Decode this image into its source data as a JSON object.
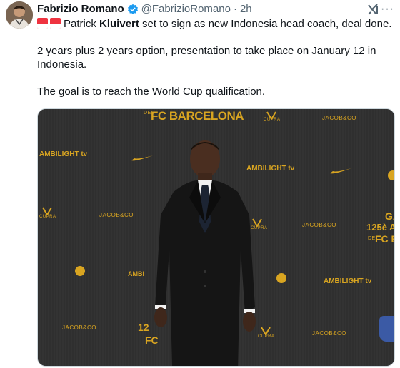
{
  "author": {
    "name": "Fabrizio Romano",
    "handle": "@FabrizioRomano",
    "separator": "·",
    "time": "2h",
    "verified": true
  },
  "header_icons": {
    "grok": "grok-icon",
    "more": "more-options-icon",
    "more_glyph": "···"
  },
  "tweet": {
    "line1_pre": "Patrick ",
    "line1_bold": "Kluivert",
    "line1_post": " set to sign as new Indonesia head coach, deal done.",
    "line2": "2 years plus 2 years option, presentation to take place on January 12 in Indonesia.",
    "line3": "The goal is to reach the World Cup qualification.",
    "flags": [
      "flag-singapore-icon",
      "flag-indonesia-icon"
    ]
  },
  "media": {
    "backdrop_texts": {
      "barcelona_top": "FC BARCELONA",
      "barcelona_top_small": "DEL",
      "ambilight_1": "AMBILIGHT tv",
      "ambilight_2": "AMBILIGHT tv",
      "ambilight_3": "AMBILIGHT tv",
      "ambilight_partial": "AMBI",
      "jacob_1": "JACOB&CO",
      "jacob_2": "JACOB&CO",
      "jacob_3": "JACOB&CO",
      "jacob_4": "JACOB&CO",
      "jacob_5": "JACOB&CO",
      "cupra_1": "CUPRA",
      "cupra_2": "CUPRA",
      "cupra_3": "CUPRA",
      "cupra_4": "CUPRA",
      "right_ga": "GA",
      "right_125": "125è A",
      "right_fcba": "FC BA",
      "right_del": "DEL",
      "bottom_125": "12",
      "bottom_fc": "FC"
    },
    "colors": {
      "gold": "#d9a521",
      "wall": "#2f2f2f"
    }
  }
}
